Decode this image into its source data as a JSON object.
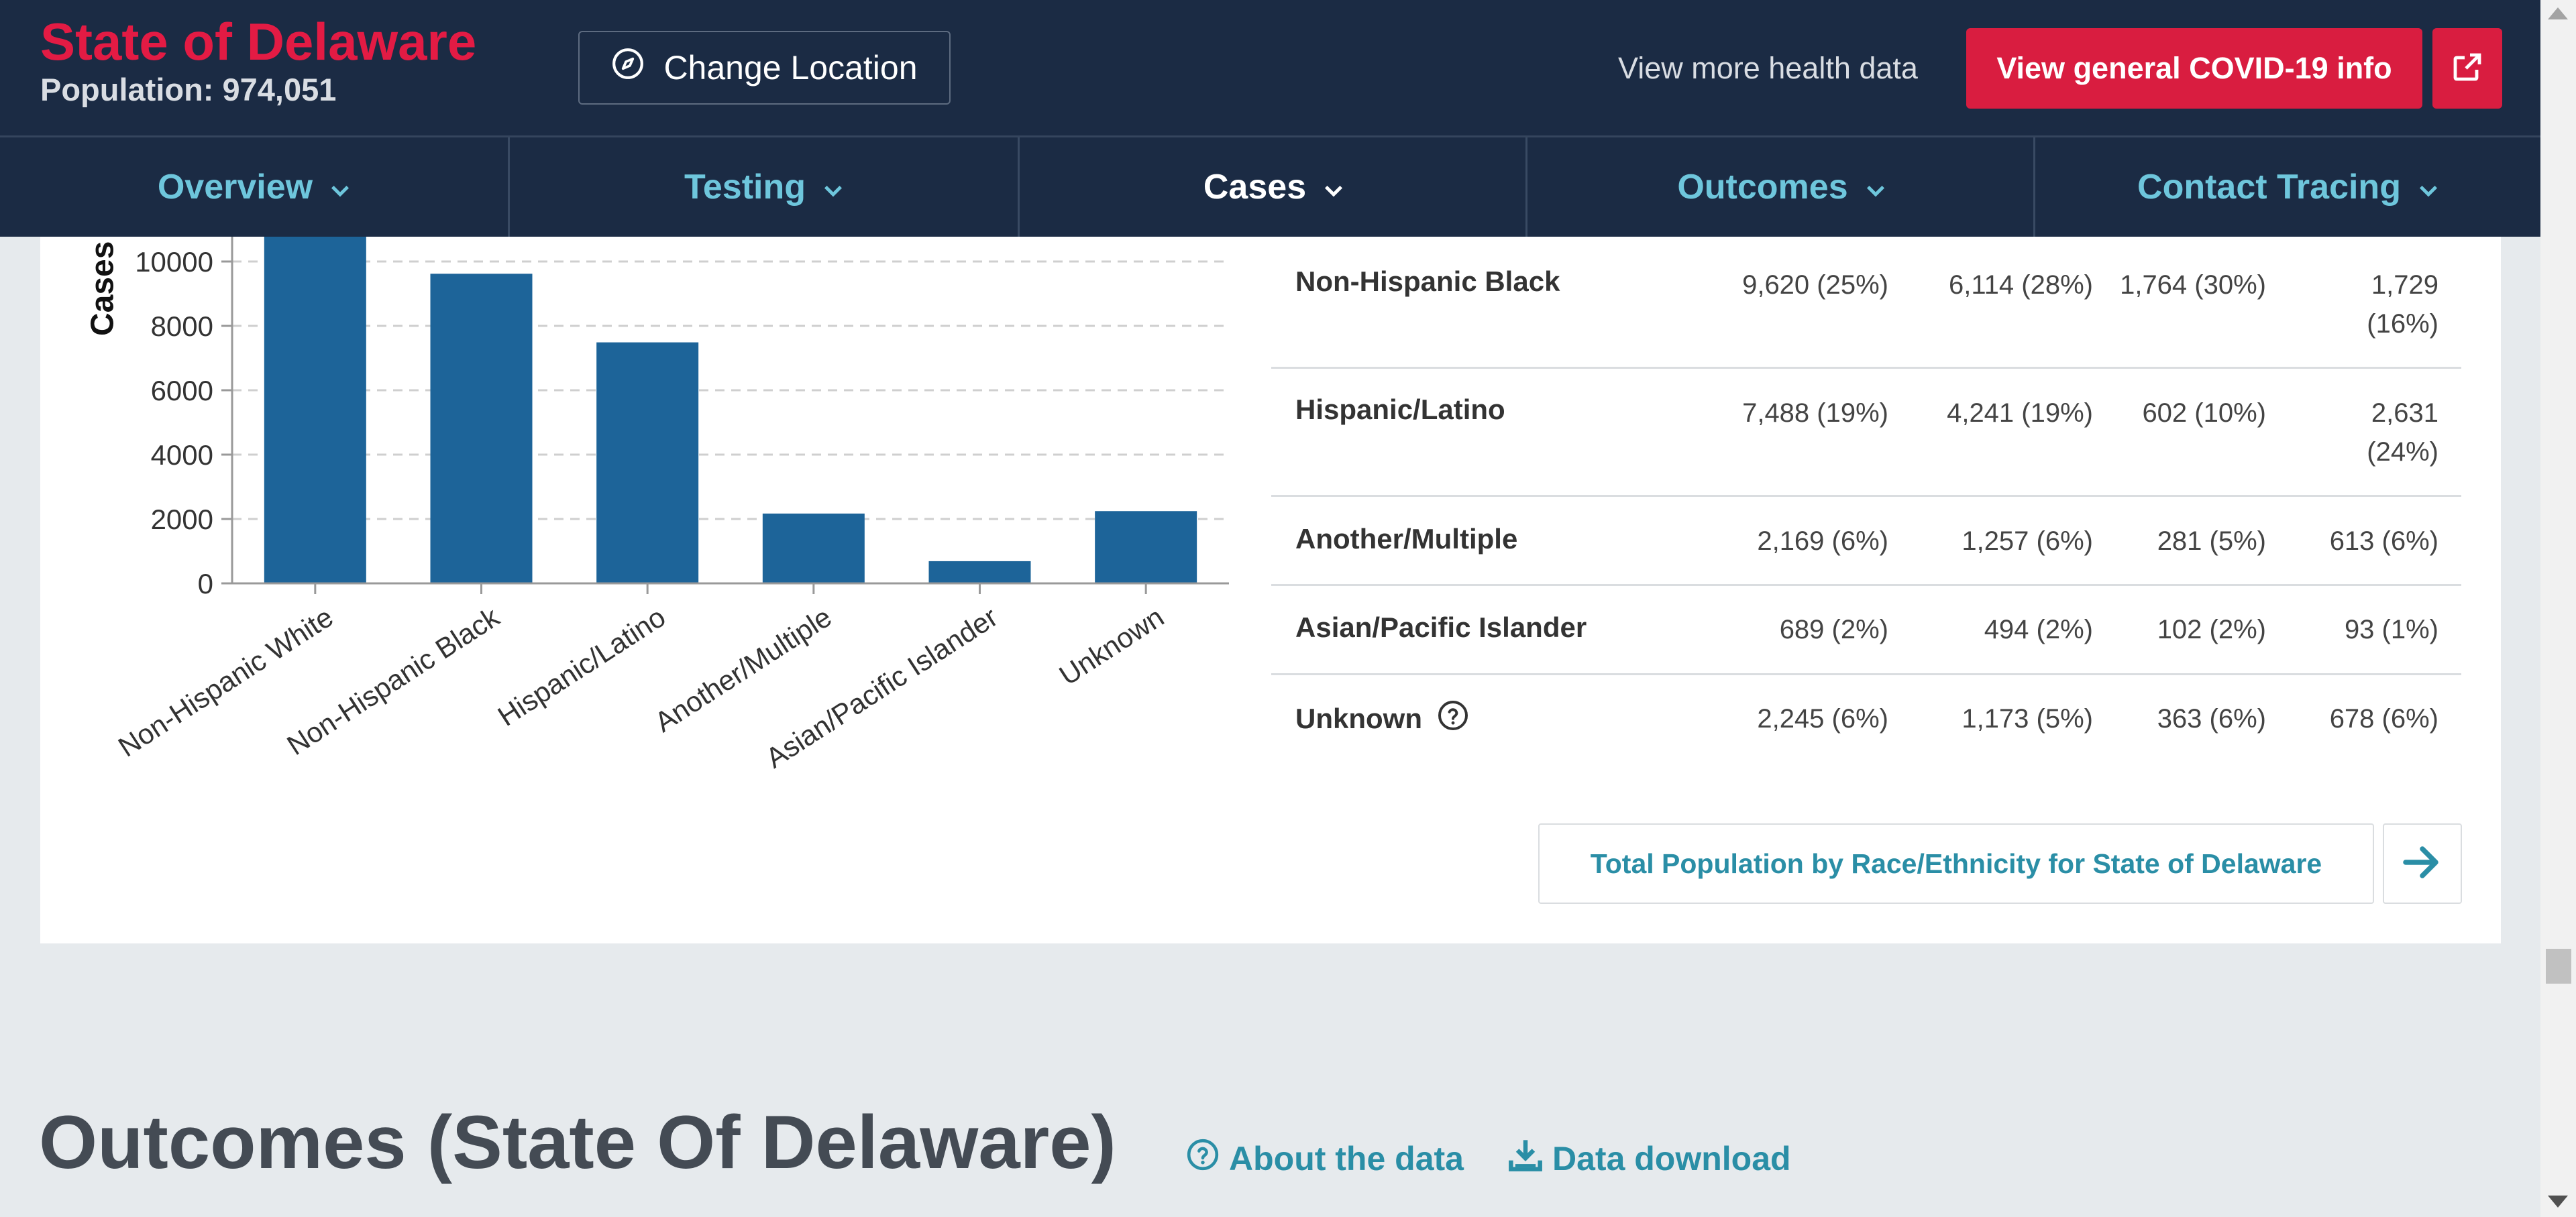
{
  "header": {
    "state_name": "State of Delaware",
    "population": "Population: 974,051",
    "change_location": "Change Location",
    "more_health_data": "View more health data",
    "covid_info": "View general COVID-19 info"
  },
  "nav": {
    "tabs": [
      {
        "label": "Overview",
        "active": false
      },
      {
        "label": "Testing",
        "active": false
      },
      {
        "label": "Cases",
        "active": true
      },
      {
        "label": "Outcomes",
        "active": false
      },
      {
        "label": "Contact Tracing",
        "active": false
      }
    ]
  },
  "chart_data": {
    "type": "bar",
    "ylabel": "Cases",
    "xlabel": "",
    "title": "",
    "categories": [
      "Non-Hispanic White",
      "Non-Hispanic Black",
      "Hispanic/Latino",
      "Another/Multiple",
      "Asian/Pacific Islander",
      "Unknown"
    ],
    "values": [
      11000,
      9620,
      7488,
      2169,
      689,
      2245
    ],
    "yticks": [
      0,
      2000,
      4000,
      6000,
      8000,
      10000
    ],
    "ylim": [
      0,
      11000
    ],
    "grid": true,
    "color": "#1d6499"
  },
  "table": {
    "rows": [
      {
        "label": "Non-Hispanic Black",
        "cells": [
          "9,620 (25%)",
          "6,114 (28%)",
          "1,764 (30%)",
          "1,729 (16%)"
        ]
      },
      {
        "label": "Hispanic/Latino",
        "cells": [
          "7,488 (19%)",
          "4,241 (19%)",
          "602 (10%)",
          "2,631 (24%)"
        ]
      },
      {
        "label": "Another/Multiple",
        "cells": [
          "2,169 (6%)",
          "1,257 (6%)",
          "281 (5%)",
          "613 (6%)"
        ]
      },
      {
        "label": "Asian/Pacific Islander",
        "cells": [
          "689 (2%)",
          "494 (2%)",
          "102 (2%)",
          "93 (1%)"
        ]
      },
      {
        "label": "Unknown",
        "cells": [
          "2,245 (6%)",
          "1,173 (5%)",
          "363 (6%)",
          "678 (6%)"
        ]
      }
    ],
    "total_population_link": "Total Population by Race/Ethnicity for State of Delaware"
  },
  "outcomes": {
    "title": "Outcomes (State Of Delaware)",
    "about_link": "About the data",
    "download_link": "Data download"
  },
  "colors": {
    "header_bg": "#1b2b44",
    "brand_red": "#e31b44",
    "accent_teal": "#2a8ea6",
    "nav_link": "#6ec6dc",
    "bar": "#1d6499"
  }
}
